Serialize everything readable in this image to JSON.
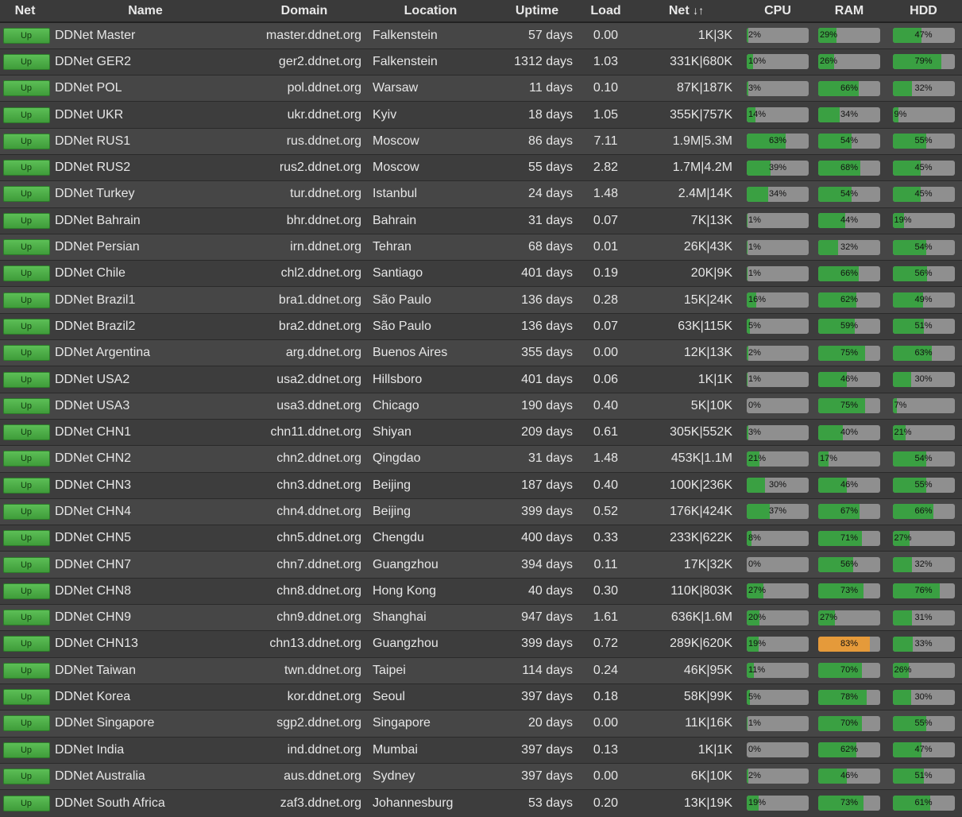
{
  "header": {
    "net": "Net",
    "name": "Name",
    "domain": "Domain",
    "location": "Location",
    "uptime": "Uptime",
    "load": "Load",
    "traffic": "Net",
    "traffic_sort": "↓↑",
    "cpu": "CPU",
    "ram": "RAM",
    "hdd": "HDD"
  },
  "colors": {
    "ok": "#3aa042",
    "warn": "#e59a3a",
    "track": "#8f8f8f"
  },
  "rows": [
    {
      "status": "Up",
      "name": "DDNet Master",
      "domain": "master.ddnet.org",
      "location": "Falkenstein",
      "uptime": "57 days",
      "load": "0.00",
      "net": "1K|3K",
      "cpu": 2,
      "ram": 29,
      "hdd": 47
    },
    {
      "status": "Up",
      "name": "DDNet GER2",
      "domain": "ger2.ddnet.org",
      "location": "Falkenstein",
      "uptime": "1312 days",
      "load": "1.03",
      "net": "331K|680K",
      "cpu": 10,
      "ram": 26,
      "hdd": 79
    },
    {
      "status": "Up",
      "name": "DDNet POL",
      "domain": "pol.ddnet.org",
      "location": "Warsaw",
      "uptime": "11 days",
      "load": "0.10",
      "net": "87K|187K",
      "cpu": 3,
      "ram": 66,
      "hdd": 32
    },
    {
      "status": "Up",
      "name": "DDNet UKR",
      "domain": "ukr.ddnet.org",
      "location": "Kyiv",
      "uptime": "18 days",
      "load": "1.05",
      "net": "355K|757K",
      "cpu": 14,
      "ram": 34,
      "hdd": 9
    },
    {
      "status": "Up",
      "name": "DDNet RUS1",
      "domain": "rus.ddnet.org",
      "location": "Moscow",
      "uptime": "86 days",
      "load": "7.11",
      "net": "1.9M|5.3M",
      "cpu": 63,
      "ram": 54,
      "hdd": 55
    },
    {
      "status": "Up",
      "name": "DDNet RUS2",
      "domain": "rus2.ddnet.org",
      "location": "Moscow",
      "uptime": "55 days",
      "load": "2.82",
      "net": "1.7M|4.2M",
      "cpu": 39,
      "ram": 68,
      "hdd": 45
    },
    {
      "status": "Up",
      "name": "DDNet Turkey",
      "domain": "tur.ddnet.org",
      "location": "Istanbul",
      "uptime": "24 days",
      "load": "1.48",
      "net": "2.4M|14K",
      "cpu": 34,
      "ram": 54,
      "hdd": 45
    },
    {
      "status": "Up",
      "name": "DDNet Bahrain",
      "domain": "bhr.ddnet.org",
      "location": "Bahrain",
      "uptime": "31 days",
      "load": "0.07",
      "net": "7K|13K",
      "cpu": 1,
      "ram": 44,
      "hdd": 19
    },
    {
      "status": "Up",
      "name": "DDNet Persian",
      "domain": "irn.ddnet.org",
      "location": "Tehran",
      "uptime": "68 days",
      "load": "0.01",
      "net": "26K|43K",
      "cpu": 1,
      "ram": 32,
      "hdd": 54
    },
    {
      "status": "Up",
      "name": "DDNet Chile",
      "domain": "chl2.ddnet.org",
      "location": "Santiago",
      "uptime": "401 days",
      "load": "0.19",
      "net": "20K|9K",
      "cpu": 1,
      "ram": 66,
      "hdd": 56
    },
    {
      "status": "Up",
      "name": "DDNet Brazil1",
      "domain": "bra1.ddnet.org",
      "location": "São Paulo",
      "uptime": "136 days",
      "load": "0.28",
      "net": "15K|24K",
      "cpu": 16,
      "ram": 62,
      "hdd": 49
    },
    {
      "status": "Up",
      "name": "DDNet Brazil2",
      "domain": "bra2.ddnet.org",
      "location": "São Paulo",
      "uptime": "136 days",
      "load": "0.07",
      "net": "63K|115K",
      "cpu": 5,
      "ram": 59,
      "hdd": 51
    },
    {
      "status": "Up",
      "name": "DDNet Argentina",
      "domain": "arg.ddnet.org",
      "location": "Buenos Aires",
      "uptime": "355 days",
      "load": "0.00",
      "net": "12K|13K",
      "cpu": 2,
      "ram": 75,
      "hdd": 63
    },
    {
      "status": "Up",
      "name": "DDNet USA2",
      "domain": "usa2.ddnet.org",
      "location": "Hillsboro",
      "uptime": "401 days",
      "load": "0.06",
      "net": "1K|1K",
      "cpu": 1,
      "ram": 46,
      "hdd": 30
    },
    {
      "status": "Up",
      "name": "DDNet USA3",
      "domain": "usa3.ddnet.org",
      "location": "Chicago",
      "uptime": "190 days",
      "load": "0.40",
      "net": "5K|10K",
      "cpu": 0,
      "ram": 75,
      "hdd": 7
    },
    {
      "status": "Up",
      "name": "DDNet CHN1",
      "domain": "chn11.ddnet.org",
      "location": "Shiyan",
      "uptime": "209 days",
      "load": "0.61",
      "net": "305K|552K",
      "cpu": 3,
      "ram": 40,
      "hdd": 21
    },
    {
      "status": "Up",
      "name": "DDNet CHN2",
      "domain": "chn2.ddnet.org",
      "location": "Qingdao",
      "uptime": "31 days",
      "load": "1.48",
      "net": "453K|1.1M",
      "cpu": 21,
      "ram": 17,
      "hdd": 54
    },
    {
      "status": "Up",
      "name": "DDNet CHN3",
      "domain": "chn3.ddnet.org",
      "location": "Beijing",
      "uptime": "187 days",
      "load": "0.40",
      "net": "100K|236K",
      "cpu": 30,
      "ram": 46,
      "hdd": 55
    },
    {
      "status": "Up",
      "name": "DDNet CHN4",
      "domain": "chn4.ddnet.org",
      "location": "Beijing",
      "uptime": "399 days",
      "load": "0.52",
      "net": "176K|424K",
      "cpu": 37,
      "ram": 67,
      "hdd": 66
    },
    {
      "status": "Up",
      "name": "DDNet CHN5",
      "domain": "chn5.ddnet.org",
      "location": "Chengdu",
      "uptime": "400 days",
      "load": "0.33",
      "net": "233K|622K",
      "cpu": 8,
      "ram": 71,
      "hdd": 27
    },
    {
      "status": "Up",
      "name": "DDNet CHN7",
      "domain": "chn7.ddnet.org",
      "location": "Guangzhou",
      "uptime": "394 days",
      "load": "0.11",
      "net": "17K|32K",
      "cpu": 0,
      "ram": 56,
      "hdd": 32
    },
    {
      "status": "Up",
      "name": "DDNet CHN8",
      "domain": "chn8.ddnet.org",
      "location": "Hong Kong",
      "uptime": "40 days",
      "load": "0.30",
      "net": "110K|803K",
      "cpu": 27,
      "ram": 73,
      "hdd": 76
    },
    {
      "status": "Up",
      "name": "DDNet CHN9",
      "domain": "chn9.ddnet.org",
      "location": "Shanghai",
      "uptime": "947 days",
      "load": "1.61",
      "net": "636K|1.6M",
      "cpu": 20,
      "ram": 27,
      "hdd": 31
    },
    {
      "status": "Up",
      "name": "DDNet CHN13",
      "domain": "chn13.ddnet.org",
      "location": "Guangzhou",
      "uptime": "399 days",
      "load": "0.72",
      "net": "289K|620K",
      "cpu": 19,
      "ram": 83,
      "hdd": 33
    },
    {
      "status": "Up",
      "name": "DDNet Taiwan",
      "domain": "twn.ddnet.org",
      "location": "Taipei",
      "uptime": "114 days",
      "load": "0.24",
      "net": "46K|95K",
      "cpu": 11,
      "ram": 70,
      "hdd": 26
    },
    {
      "status": "Up",
      "name": "DDNet Korea",
      "domain": "kor.ddnet.org",
      "location": "Seoul",
      "uptime": "397 days",
      "load": "0.18",
      "net": "58K|99K",
      "cpu": 5,
      "ram": 78,
      "hdd": 30
    },
    {
      "status": "Up",
      "name": "DDNet Singapore",
      "domain": "sgp2.ddnet.org",
      "location": "Singapore",
      "uptime": "20 days",
      "load": "0.00",
      "net": "11K|16K",
      "cpu": 1,
      "ram": 70,
      "hdd": 55
    },
    {
      "status": "Up",
      "name": "DDNet India",
      "domain": "ind.ddnet.org",
      "location": "Mumbai",
      "uptime": "397 days",
      "load": "0.13",
      "net": "1K|1K",
      "cpu": 0,
      "ram": 62,
      "hdd": 47
    },
    {
      "status": "Up",
      "name": "DDNet Australia",
      "domain": "aus.ddnet.org",
      "location": "Sydney",
      "uptime": "397 days",
      "load": "0.00",
      "net": "6K|10K",
      "cpu": 2,
      "ram": 46,
      "hdd": 51
    },
    {
      "status": "Up",
      "name": "DDNet South Africa",
      "domain": "zaf3.ddnet.org",
      "location": "Johannesburg",
      "uptime": "53 days",
      "load": "0.20",
      "net": "13K|19K",
      "cpu": 19,
      "ram": 73,
      "hdd": 61
    }
  ]
}
